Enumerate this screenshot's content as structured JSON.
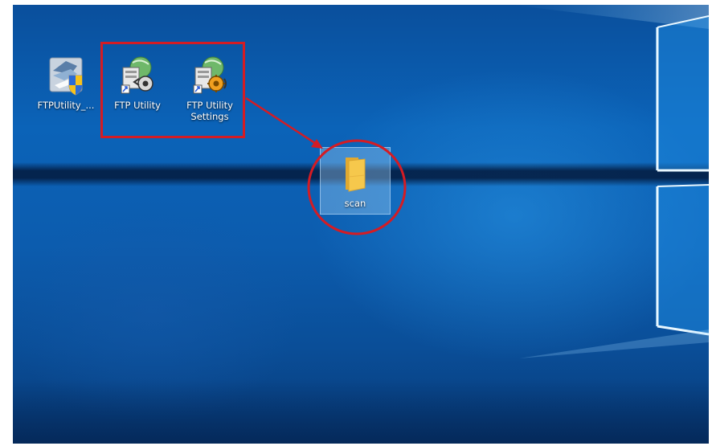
{
  "desktop": {
    "icons": [
      {
        "label": "FTPUtility_...",
        "icon": "installer-shield-icon"
      },
      {
        "label": "FTP Utility",
        "icon": "ftp-utility-icon"
      },
      {
        "label": "FTP Utility Settings",
        "icon": "ftp-utility-settings-icon"
      },
      {
        "label": "scan",
        "icon": "folder-icon"
      }
    ],
    "selected_icon": "scan"
  },
  "annotations": {
    "color": "#d41c24",
    "shapes": [
      "rectangle around FTP Utility icons",
      "arrow",
      "circle around scan folder"
    ]
  },
  "colors": {
    "wallpaper_blue": "#0b63b8",
    "highlight_red": "#d41c24",
    "folder_yellow": "#f6c84c"
  }
}
